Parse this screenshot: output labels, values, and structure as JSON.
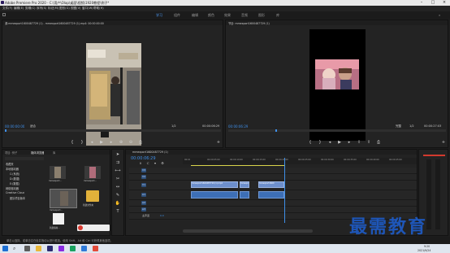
{
  "window": {
    "title": "Adobe Premiere Pro 2020 - C:\\用户\\Olap\\桌面\\视频\\1920教程\\例子*"
  },
  "menu": [
    "文件(F)",
    "编辑(E)",
    "剪辑(C)",
    "序列(S)",
    "标记(M)",
    "图形(G)",
    "视图(V)",
    "窗口(W)",
    "帮助(H)"
  ],
  "workspaces": [
    {
      "label": "学习",
      "active": true
    },
    {
      "label": "组件",
      "active": false
    },
    {
      "label": "编辑",
      "active": false
    },
    {
      "label": "颜色",
      "active": false
    },
    {
      "label": "效果",
      "active": false
    },
    {
      "label": "音频",
      "active": false
    },
    {
      "label": "图形",
      "active": false
    },
    {
      "label": "库",
      "active": false
    }
  ],
  "source_monitor": {
    "tab": "源:mmexport1600487729 (1) - mmexport1600487729 (1).mp4: 00:00:00:00",
    "timecode": "00:00:00:00",
    "fit_label": "适合",
    "quality": "1/2",
    "duration": "00:00:06:29"
  },
  "program_monitor": {
    "tab": "节目: mmexport1600487729 (1)",
    "timecode": "00:00:06:29",
    "fit_label": "完整",
    "quality": "1/2",
    "duration": "00:00:27:03"
  },
  "project_panel": {
    "tabs": [
      "项目: 例子",
      "媒体浏览器",
      "库"
    ],
    "active_tab": "媒体浏览器",
    "tree": [
      "收藏夹",
      "本地驱动器",
      "C:(系统)",
      "D:(数据)",
      "E:(数据)",
      "网络驱动器",
      "Creative Cloud",
      "团队项目版本"
    ],
    "items": [
      {
        "label": "mmexport..."
      },
      {
        "label": "mmexport..."
      },
      {
        "label": "mmexport..."
      },
      {
        "label": "图片"
      },
      {
        "label": "mmexport..."
      },
      {
        "label": "新建文件夹"
      }
    ],
    "bottom_label": "新建素材..."
  },
  "timeline": {
    "tab": "mmexport1600487729 (1)",
    "timecode": "00:00:06:29",
    "ruler": [
      "00:00",
      "00:00:05:00",
      "00:00:10:00",
      "00:00:15:00",
      "00:00:20:00",
      "00:00:25:00",
      "00:00:30:00",
      "00:00:35:00",
      "00:00:40:00",
      "00:00:45:00"
    ],
    "tracks": [
      "V3",
      "V2",
      "V1",
      "A1",
      "A2",
      "A3",
      "主声道"
    ],
    "master_value": "0.0",
    "clips": [
      "mmexport1600487729 (1).mp4",
      "mmexport",
      "mmexport1600",
      "mmexport1600487729"
    ]
  },
  "status_bar": {
    "text": "单击以选择，或单击空白处并拖动以进行框选。使用 Shift、Alt 和 Ctrl 可获得其他选项。"
  },
  "taskbar": {
    "time": "9:20",
    "date": "2021/9/24",
    "search_icon": "search-icon",
    "windows_icon": "windows-logo-icon"
  },
  "watermark": {
    "text": "最需教育"
  }
}
